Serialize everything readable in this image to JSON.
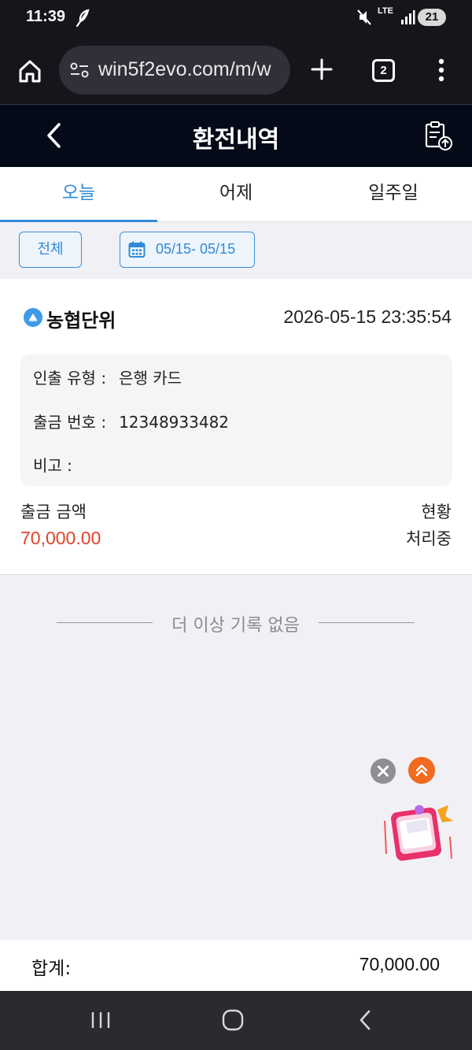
{
  "status_bar": {
    "time": "11:39",
    "network": "LTE",
    "battery": "21"
  },
  "browser": {
    "url": "win5f2evo.com/m/w",
    "tab_count": "2"
  },
  "header": {
    "title": "환전내역"
  },
  "tabs": [
    {
      "label": "오늘",
      "active": true
    },
    {
      "label": "어제",
      "active": false
    },
    {
      "label": "일주일",
      "active": false
    }
  ],
  "filters": {
    "all_label": "전체",
    "date_range": "05/15- 05/15"
  },
  "record": {
    "bank": "농협단위",
    "datetime": "2026-05-15 23:35:54",
    "details": [
      {
        "label": "인출 유형 :",
        "value": "은행 카드"
      },
      {
        "label": "출금 번호 :",
        "value": "12348933482"
      },
      {
        "label": "비고 :",
        "value": ""
      }
    ],
    "amount_label": "출금 금액",
    "amount": "70,000.00",
    "status_label": "현황",
    "status": "처리중"
  },
  "end_message": "더 이상 기록 없음",
  "total": {
    "label": "합계:",
    "value": "70,000.00"
  },
  "colors": {
    "accent": "#2f8bd7",
    "amount": "#e0442b",
    "header_bg": "#050a18"
  }
}
